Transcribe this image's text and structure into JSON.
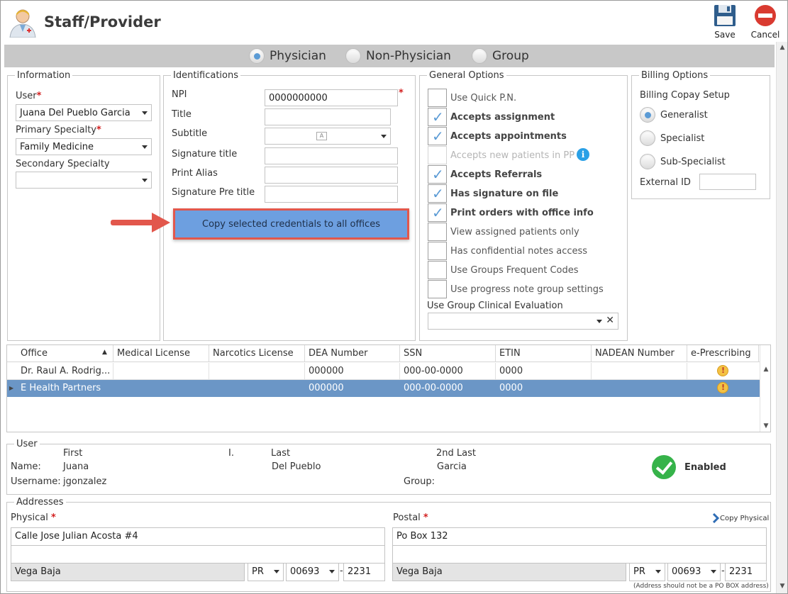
{
  "window": {
    "title": "Staff/Provider"
  },
  "toolbar": {
    "save_label": "Save",
    "cancel_label": "Cancel"
  },
  "provider_type": {
    "options": [
      "Physician",
      "Non-Physician",
      "Group"
    ],
    "selected": "Physician"
  },
  "information": {
    "legend": "Information",
    "user_label": "User",
    "user_value": "Juana Del Pueblo Garcia",
    "primary_specialty_label": "Primary Specialty",
    "primary_specialty_value": "Family Medicine",
    "secondary_specialty_label": "Secondary Specialty",
    "secondary_specialty_value": ""
  },
  "identifications": {
    "legend": "Identifications",
    "npi_label": "NPI",
    "npi_value": "0000000000",
    "title_label": "Title",
    "title_value": "",
    "subtitle_label": "Subtitle",
    "signature_title_label": "Signature title",
    "print_alias_label": "Print Alias",
    "signature_pre_title_label": "Signature Pre title",
    "copy_button_label": "Copy selected credentials to all offices"
  },
  "general_options": {
    "legend": "General Options",
    "items": [
      {
        "label": "Use Quick P.N.",
        "checked": false,
        "enabled": true
      },
      {
        "label": "Accepts assignment",
        "checked": true,
        "enabled": true
      },
      {
        "label": "Accepts appointments",
        "checked": true,
        "enabled": true
      },
      {
        "label": "Accepts new patients in PP",
        "checked": false,
        "enabled": false
      },
      {
        "label": "Accepts Referrals",
        "checked": true,
        "enabled": true
      },
      {
        "label": "Has signature on file",
        "checked": true,
        "enabled": true
      },
      {
        "label": "Print orders with office info",
        "checked": true,
        "enabled": true
      },
      {
        "label": "View assigned patients only",
        "checked": false,
        "enabled": true
      },
      {
        "label": "Has confidential notes access",
        "checked": false,
        "enabled": true
      },
      {
        "label": "Use Groups Frequent Codes",
        "checked": false,
        "enabled": true
      },
      {
        "label": "Use progress note group settings",
        "checked": false,
        "enabled": true
      }
    ],
    "clinical_eval_label": "Use Group Clinical Evaluation",
    "clinical_eval_value": "",
    "info_icon": "i"
  },
  "billing_options": {
    "legend": "Billing Options",
    "copay_setup_label": "Billing Copay Setup",
    "copay_options": [
      "Generalist",
      "Specialist",
      "Sub-Specialist"
    ],
    "copay_selected": "Generalist",
    "external_id_label": "External ID",
    "external_id_value": ""
  },
  "offices_grid": {
    "columns": [
      "Office",
      "Medical License",
      "Narcotics License",
      "DEA Number",
      "SSN",
      "ETIN",
      "NADEAN Number",
      "e-Prescribing"
    ],
    "rows": [
      {
        "office": "Dr. Raul A. Rodrig...",
        "medical_license": "",
        "narcotics_license": "",
        "dea": "000000",
        "ssn": "000-00-0000",
        "etin": "0000",
        "nadean": "",
        "selected": false
      },
      {
        "office": "E Health Partners",
        "medical_license": "",
        "narcotics_license": "",
        "dea": "000000",
        "ssn": "000-00-0000",
        "etin": "0000",
        "nadean": "",
        "selected": true
      }
    ]
  },
  "user_section": {
    "legend": "User",
    "first_header": "First",
    "middle_header": "I.",
    "last_header": "Last",
    "second_last_header": "2nd Last",
    "name_label": "Name:",
    "first": "Juana",
    "last": "Del Pueblo",
    "second_last": "Garcia",
    "username_label": "Username:",
    "username": "jgonzalez",
    "group_label": "Group:",
    "group": "",
    "status": "Enabled"
  },
  "addresses": {
    "legend": "Addresses",
    "physical_label": "Physical",
    "physical_line1": "Calle Jose Julian Acosta #4",
    "physical_line2": "",
    "physical_city": "Vega Baja",
    "physical_state": "PR",
    "physical_zip": "00693",
    "physical_zip4": "2231",
    "postal_label": "Postal",
    "postal_line1": "Po Box 132",
    "postal_line2": "",
    "postal_city": "Vega Baja",
    "postal_state": "PR",
    "postal_zip": "00693",
    "postal_zip4": "2231",
    "copy_physical_label": "Copy Physical",
    "note": "(Address should not be a PO BOX address)",
    "dash": "-"
  },
  "colors": {
    "accent": "#5b9bd5",
    "selected_row": "#6b96c6",
    "highlight_border": "#e2574c",
    "enabled": "#36b34a"
  }
}
